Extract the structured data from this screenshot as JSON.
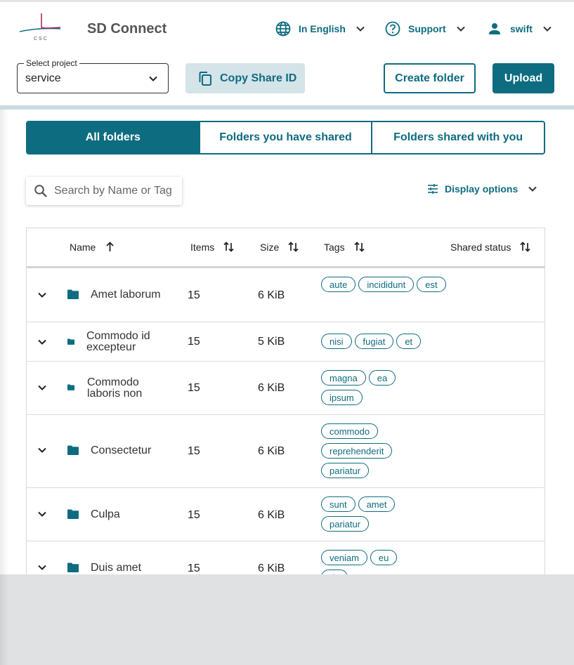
{
  "app": {
    "title": "SD Connect",
    "logo_text": "CSC"
  },
  "nav": {
    "language": "In English",
    "support": "Support",
    "user": "swift"
  },
  "project_select": {
    "legend": "Select project",
    "value": "service"
  },
  "actions": {
    "copy_share_id": "Copy Share ID",
    "create_folder": "Create folder",
    "upload": "Upload"
  },
  "tabs": [
    {
      "label": "All folders",
      "active": true
    },
    {
      "label": "Folders you have shared",
      "active": false
    },
    {
      "label": "Folders shared with you",
      "active": false
    }
  ],
  "search": {
    "placeholder": "Search by Name or Tag"
  },
  "display_options": {
    "label": "Display options"
  },
  "table": {
    "columns": [
      "Name",
      "Items",
      "Size",
      "Tags",
      "Shared status"
    ],
    "rows": [
      {
        "name": "Amet laborum",
        "items": "15",
        "size": "6 KiB",
        "tags": [
          "aute",
          "incididunt",
          "est"
        ],
        "shared_status": ""
      },
      {
        "name": "Commodo id excepteur",
        "items": "15",
        "size": "5 KiB",
        "tags": [
          "nisi",
          "fugiat",
          "et"
        ],
        "shared_status": ""
      },
      {
        "name": "Commodo laboris non",
        "items": "15",
        "size": "6 KiB",
        "tags": [
          "magna",
          "ea",
          "ipsum"
        ],
        "shared_status": ""
      },
      {
        "name": "Consectetur",
        "items": "15",
        "size": "6 KiB",
        "tags": [
          "commodo",
          "reprehenderit",
          "pariatur"
        ],
        "shared_status": ""
      },
      {
        "name": "Culpa",
        "items": "15",
        "size": "6 KiB",
        "tags": [
          "sunt",
          "amet",
          "pariatur"
        ],
        "shared_status": ""
      },
      {
        "name": "Duis amet",
        "items": "15",
        "size": "6 KiB",
        "tags": [
          "veniam",
          "eu",
          "do"
        ],
        "shared_status": ""
      }
    ]
  },
  "colors": {
    "primary": "#0e6c80",
    "primary_light": "#d4e4e9",
    "logo_accent": "#a3195b"
  },
  "icons": {
    "language": "globe-icon",
    "support": "help-circle-icon",
    "user": "person-icon",
    "copy": "copy-icon",
    "search": "search-icon",
    "display_options": "tune-icon",
    "sort": "sort-arrows-icon",
    "folder": "folder-icon",
    "expand": "chevron-down-icon"
  }
}
